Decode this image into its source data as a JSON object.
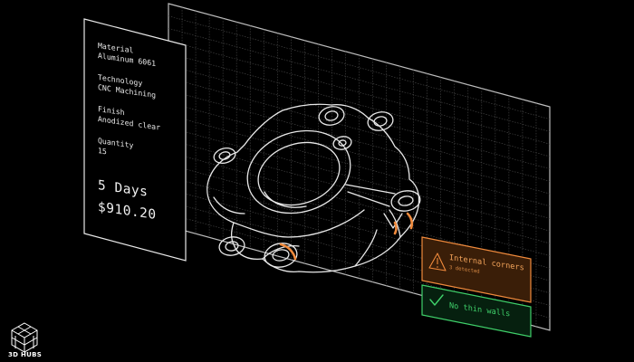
{
  "specs": {
    "material_label": "Material",
    "material_value": "Aluminum 6061",
    "technology_label": "Technology",
    "technology_value": "CNC Machining",
    "finish_label": "Finish",
    "finish_value": "Anodized clear",
    "quantity_label": "Quantity",
    "quantity_value": "15",
    "lead_time": "5 Days",
    "price": "$910.20"
  },
  "checks": {
    "warning_title": "Internal corners",
    "warning_detail": "3 detected",
    "success_title": "No thin walls"
  },
  "brand": {
    "name": "3D HUBS"
  },
  "icons": {
    "warning": "warning-triangle-icon",
    "success": "checkmark-icon",
    "logo": "hubs-cube-logo-icon"
  },
  "colors": {
    "background": "#000000",
    "line": "#e8e8e8",
    "grid": "#4a4a4a",
    "warning": "#f08a3c",
    "warning_fill": "#3a1e08",
    "success": "#3fd06a",
    "success_fill": "#06200f"
  }
}
